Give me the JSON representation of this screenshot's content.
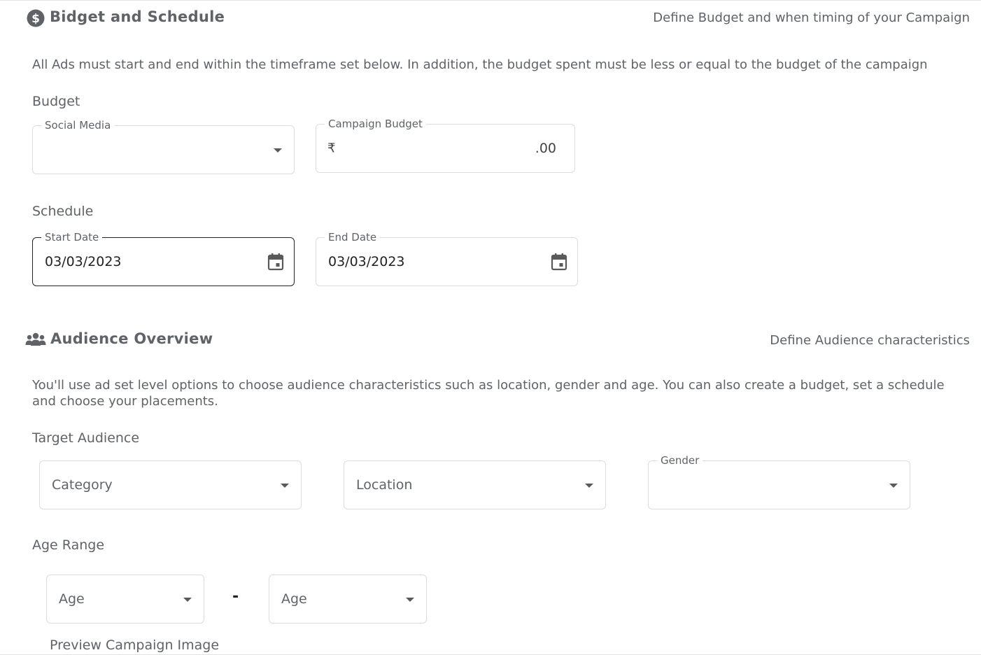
{
  "budget_section": {
    "icon": "dollar-circle-icon",
    "title": "Bidget and Schedule",
    "subtitle": "Define Budget and when timing of your Campaign",
    "description": "All Ads must start and end within the timeframe set below. In addition, the budget spent must be less or equal to the budget of the campaign",
    "budget_label": "Budget",
    "social_media": {
      "label": "Social Media",
      "value": ""
    },
    "campaign_budget": {
      "label": "Campaign Budget",
      "currency_symbol": "₹",
      "value": "",
      "suffix": ".00"
    },
    "schedule_label": "Schedule",
    "start_date": {
      "label": "Start Date",
      "value": "03/03/2023"
    },
    "end_date": {
      "label": "End Date",
      "value": "03/03/2023"
    }
  },
  "audience_section": {
    "icon": "users-group-icon",
    "title": "Audience Overview",
    "subtitle": "Define Audience characteristics",
    "description": "You'll use ad set level options to choose audience characteristics such as location, gender and age. You can also create a budget, set a schedule and choose your placements.",
    "target_label": "Target Audience",
    "category": {
      "placeholder": "Category"
    },
    "location": {
      "placeholder": "Location"
    },
    "gender": {
      "label": "Gender",
      "value": ""
    },
    "age_range_label": "Age Range",
    "age_min": {
      "placeholder": "Age"
    },
    "age_separator": "-",
    "age_max": {
      "placeholder": "Age"
    },
    "preview_label": "Preview Campaign Image"
  },
  "colors": {
    "text": "#5f6368",
    "value_text": "#222222",
    "border": "#dcdcdc",
    "focused_border": "#222222"
  }
}
